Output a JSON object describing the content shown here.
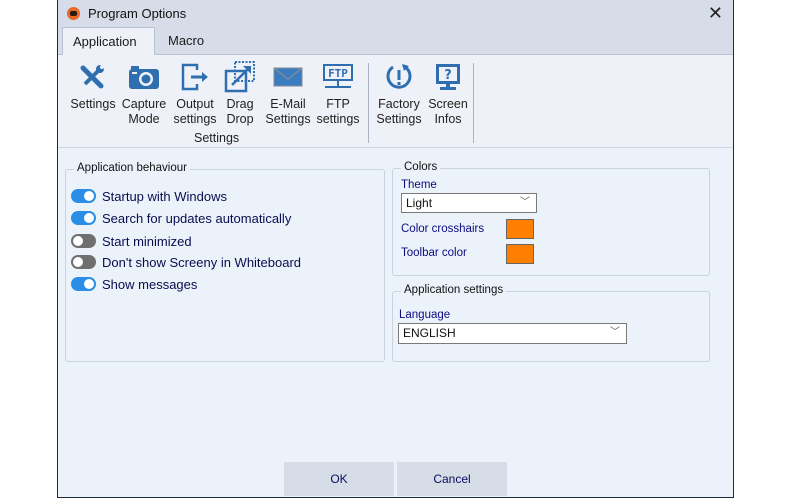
{
  "window": {
    "title": "Program Options"
  },
  "tabs": [
    {
      "label": "Application"
    },
    {
      "label": "Macro"
    }
  ],
  "ribbon": {
    "settings_group": {
      "label": "Settings",
      "buttons": [
        {
          "label1": "Settings",
          "label2": "",
          "icon": "tools-icon"
        },
        {
          "label1": "Capture",
          "label2": "Mode",
          "icon": "camera-icon"
        },
        {
          "label1": "Output",
          "label2": "settings",
          "icon": "output-icon"
        },
        {
          "label1": "Drag",
          "label2": "Drop",
          "icon": "drag-drop-icon"
        },
        {
          "label1": "E-Mail",
          "label2": "Settings",
          "icon": "email-icon"
        },
        {
          "label1": "FTP",
          "label2": "settings",
          "icon": "ftp-icon"
        }
      ]
    },
    "other_group": {
      "buttons": [
        {
          "label1": "Factory",
          "label2": "Settings",
          "icon": "factory-reset-icon"
        },
        {
          "label1": "Screen",
          "label2": "Infos",
          "icon": "screen-info-icon"
        }
      ]
    }
  },
  "behaviour": {
    "title": "Application behaviour",
    "options": [
      {
        "label": "Startup with Windows",
        "on": true
      },
      {
        "label": "Search for updates automatically",
        "on": true
      },
      {
        "label": "Start minimized",
        "on": false
      },
      {
        "label": "Don't show Screeny in Whiteboard",
        "on": false
      },
      {
        "label": "Show messages",
        "on": true
      }
    ]
  },
  "colors": {
    "title": "Colors",
    "theme_label": "Theme",
    "theme_value": "Light",
    "crosshairs_label": "Color crosshairs",
    "crosshairs_color": "#ff8000",
    "toolbar_label": "Toolbar color",
    "toolbar_color": "#ff8000"
  },
  "app_settings": {
    "title": "Application settings",
    "language_label": "Language",
    "language_value": "ENGLISH"
  },
  "footer": {
    "ok_label": "OK",
    "cancel_label": "Cancel"
  }
}
